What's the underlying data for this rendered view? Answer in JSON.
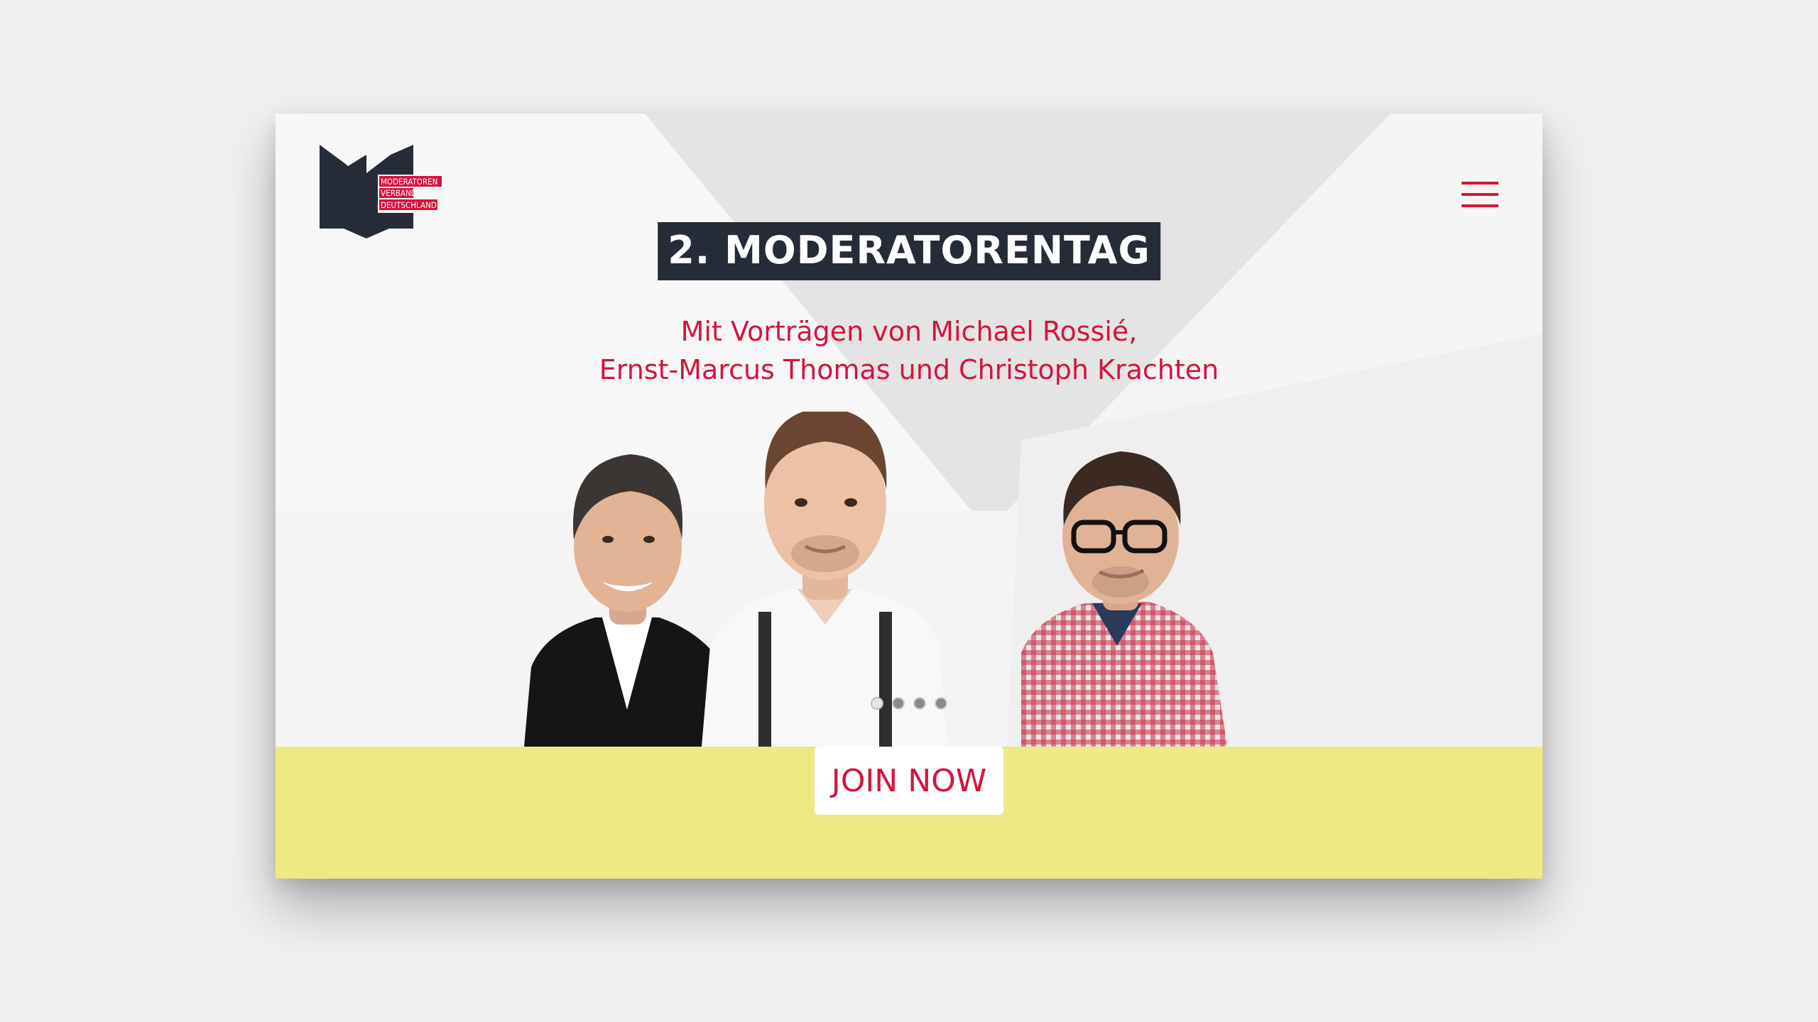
{
  "logo": {
    "line1": "MODERATOREN",
    "line2": "VERBAND",
    "line3": "DEUTSCHLAND",
    "brand_color": "#d4143c",
    "mark_color": "#262b38"
  },
  "header": {
    "menu_icon": "hamburger-menu-icon"
  },
  "hero": {
    "title": "2. MODERATORENTAG",
    "subtitle_line1": "Mit Vorträgen von Michael Rossié,",
    "subtitle_line2": "Ernst-Marcus Thomas und Christoph Krachten",
    "speakers": [
      "Michael Rossié",
      "Ernst-Marcus Thomas",
      "Christoph Krachten"
    ]
  },
  "carousel": {
    "dot_count": 4,
    "active_index": 0
  },
  "cta": {
    "label": "JOIN NOW",
    "band_color": "#ede983"
  }
}
